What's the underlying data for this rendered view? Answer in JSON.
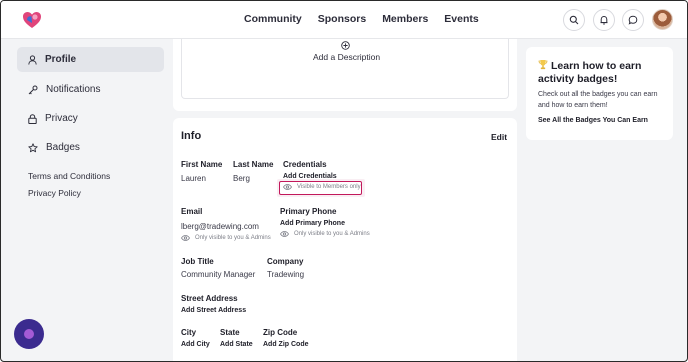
{
  "nav": {
    "items": [
      "Community",
      "Sponsors",
      "Members",
      "Events"
    ]
  },
  "icons": {
    "logo": "heart-logo-icon",
    "search": "search-icon",
    "bell": "bell-icon",
    "chat": "chat-icon",
    "user": "user-icon",
    "key": "key-icon",
    "lock": "lock-icon",
    "star": "star-icon",
    "eye": "eye-icon",
    "plus": "plus-circle-icon",
    "trophy": "trophy-icon"
  },
  "sidebar": {
    "items": [
      {
        "label": "Profile",
        "active": true
      },
      {
        "label": "Notifications"
      },
      {
        "label": "Privacy"
      },
      {
        "label": "Badges"
      }
    ],
    "links": [
      "Terms and Conditions",
      "Privacy Policy"
    ]
  },
  "main": {
    "add_description": "Add a Description",
    "info_title": "Info",
    "edit_label": "Edit",
    "fields": {
      "first_name": {
        "label": "First Name",
        "value": "Lauren"
      },
      "last_name": {
        "label": "Last Name",
        "value": "Berg"
      },
      "credentials": {
        "label": "Credentials",
        "action": "Add Credentials",
        "visibility": "Visible to Members only"
      },
      "email": {
        "label": "Email",
        "value": "lberg@tradewing.com",
        "visibility": "Only visible to you & Admins"
      },
      "primary_phone": {
        "label": "Primary Phone",
        "action": "Add Primary Phone",
        "visibility": "Only visible to you & Admins"
      },
      "job_title": {
        "label": "Job Title",
        "value": "Community Manager"
      },
      "company": {
        "label": "Company",
        "value": "Tradewing"
      },
      "street_address": {
        "label": "Street Address",
        "action": "Add Street Address"
      },
      "city": {
        "label": "City",
        "action": "Add City"
      },
      "state": {
        "label": "State",
        "action": "Add State"
      },
      "zip": {
        "label": "Zip Code",
        "action": "Add Zip Code"
      }
    }
  },
  "badge_card": {
    "title": "Learn how to earn activity badges!",
    "body": "Check out all the badges you can earn and how to earn them!",
    "link": "See All the Badges You Can Earn"
  },
  "colors": {
    "highlight": "#c2185b",
    "fab": "#3b2b8f"
  }
}
